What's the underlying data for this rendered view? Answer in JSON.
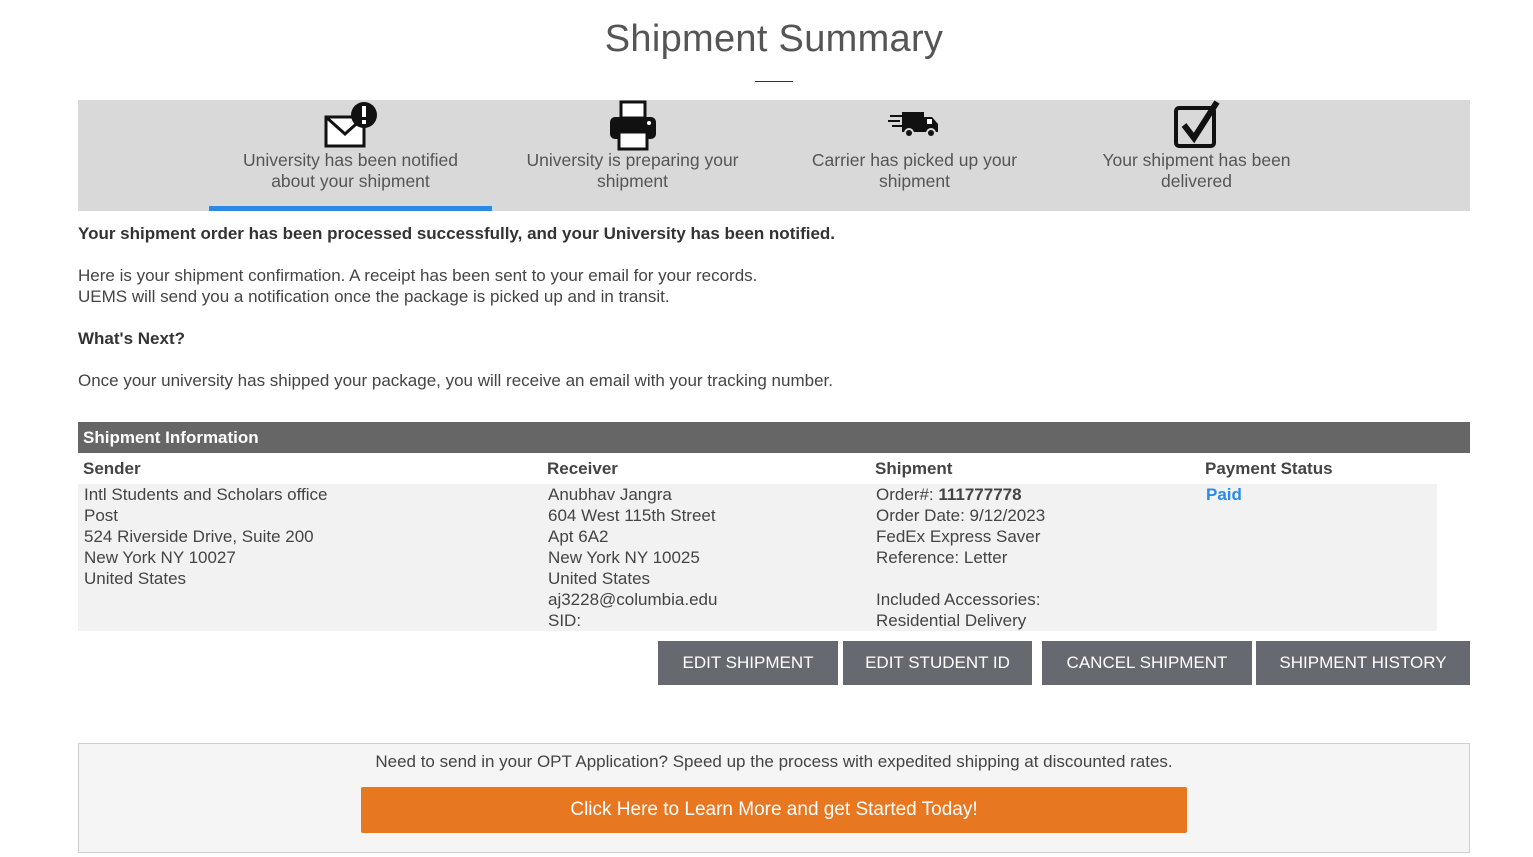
{
  "page": {
    "title": "Shipment Summary"
  },
  "progress": {
    "steps": [
      {
        "icon": "envelope-alert-icon",
        "label": "University has been notified about your shipment"
      },
      {
        "icon": "printer-icon",
        "label": "University is preparing your shipment"
      },
      {
        "icon": "delivery-truck-icon",
        "label": "Carrier has picked up your shipment"
      },
      {
        "icon": "checked-box-icon",
        "label": "Your shipment has been delivered"
      }
    ],
    "active_step": 0
  },
  "messages": {
    "success": "Your shipment order has been processed successfully, and your University has been notified.",
    "confirmation_line1": "Here is your shipment confirmation. A receipt has been sent to your email for your records.",
    "confirmation_line2": "UEMS will send you a notification once the package is picked up and in transit.",
    "whats_next_heading": "What's Next?",
    "whats_next_text": "Once your university has shipped your package, you will receive an email with your tracking number."
  },
  "shipment_info": {
    "header": "Shipment Information",
    "columns": {
      "sender": "Sender",
      "receiver": "Receiver",
      "shipment": "Shipment",
      "payment": "Payment Status"
    },
    "sender": [
      "Intl Students and Scholars office",
      "Post",
      "524 Riverside Drive, Suite 200",
      "New York NY 10027",
      "United States"
    ],
    "receiver": [
      "Anubhav Jangra",
      "604 West 115th Street",
      "Apt 6A2",
      "New York NY 10025",
      "United States",
      "aj3228@columbia.edu",
      "SID:"
    ],
    "shipment": {
      "order_label": "Order#: ",
      "order_number": "111777778",
      "order_date": "Order Date: 9/12/2023",
      "service": "FedEx Express Saver",
      "reference": "Reference: Letter",
      "accessories_label": "Included Accessories:",
      "accessory": "Residential Delivery"
    },
    "payment_status": "Paid"
  },
  "actions": {
    "edit_shipment": "EDIT SHIPMENT",
    "edit_student_id": "EDIT STUDENT ID",
    "cancel_shipment": "CANCEL SHIPMENT",
    "shipment_history": "SHIPMENT HISTORY"
  },
  "promo": {
    "text": "Need to send in your OPT Application? Speed up the process with expedited shipping at discounted rates.",
    "button": "Click Here to Learn More and get Started Today!"
  },
  "colors": {
    "accent_blue": "#2b8ae8",
    "promo_orange": "#e87722",
    "button_gray": "#666a70",
    "header_gray": "#666666"
  }
}
